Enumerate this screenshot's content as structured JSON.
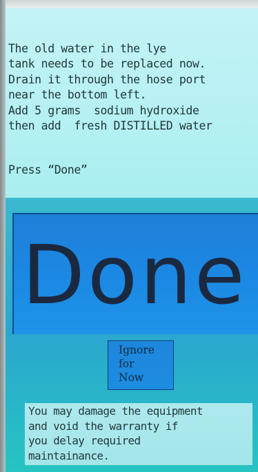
{
  "message": {
    "lines": [
      "The old water in the lye",
      "tank needs to be replaced now.",
      "Drain it through the hose port",
      "near the bottom left.",
      "Add 5 grams  sodium hydroxide",
      "then add  fresh DISTILLED water"
    ],
    "prompt": "Press “Done”"
  },
  "done_button": {
    "label": "Done"
  },
  "ignore_button": {
    "lines": [
      "Ignore",
      "for",
      "Now"
    ]
  },
  "warning": {
    "lines": [
      "You may damage the equipment",
      "and void the warranty if",
      "you delay required",
      "maintainance."
    ]
  }
}
